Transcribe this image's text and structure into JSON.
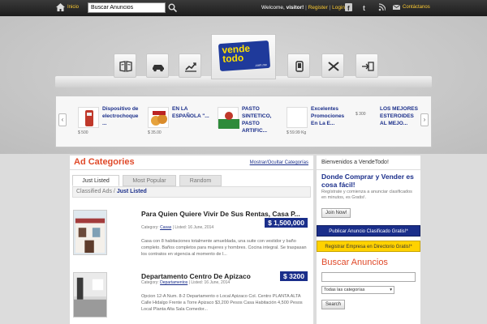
{
  "topbar": {
    "home_label": "Inicio",
    "search_value": "Buscar Anuncios",
    "welcome_text": "Welcome,",
    "welcome_user": "visitor!",
    "register_label": "Register",
    "login_label": "Login",
    "contact_label": "Contáctanos"
  },
  "logo": {
    "line1": "vende",
    "line2": "todo",
    "domain": ".com.mx"
  },
  "carousel": [
    {
      "title": "Dispositivo de electrochoque ...",
      "price": "$ 500"
    },
    {
      "title": "EN LA ESPAÑOLA \"...",
      "price": "$ 35.00"
    },
    {
      "title": "PASTO SINTETICO, PASTO ARTIFIC...",
      "price": ""
    },
    {
      "title": "Excelentes Promociones En La E...",
      "price": "$ 59.99 Kg"
    },
    {
      "title": "LOS MEJORES ESTEROIDES AL MEJO...",
      "price": "$ 300"
    }
  ],
  "main": {
    "title": "Ad Categories",
    "toggle_label": "Mostrar/Ocultar Categorías",
    "tabs": [
      "Just Listed",
      "Most Popular",
      "Random"
    ],
    "crumb_root": "Classified Ads",
    "crumb_sep": " / ",
    "crumb_current": "Just Listed",
    "listings": [
      {
        "title": "Para Quien Quiere Vivir De Sus Rentas, Casa P...",
        "price": "$ 1,500,000",
        "category_label": "Category:",
        "category": "Casas",
        "listed": "| Listed: 16 June, 2014",
        "description": "Casa con 8 habitaciones totalmente amueblada, una suite con vestidor y baño completo. Baños completos para mujeres y hombres. Cocina integral. Se traspasan los contratos en vigencia al momento de l..."
      },
      {
        "title": "Departamento Centro De Apizaco",
        "price": "$ 3200",
        "category_label": "Category:",
        "category": "Departamentos",
        "listed": "| Listed: 16 June, 2014",
        "description": "Opcion 12-A Num. 8-2 Departamento o Local Apizaco Col. Centro PLANTA ALTA Calle Hidalgo Frente a Torre Apizaco $3,200 Pesos Casa Habitación 4,500 Pesos Local Planta Alta Sala Comedor..."
      }
    ]
  },
  "sidebar": {
    "welcome": "Bienvenidos a VendeTodo!",
    "headline": "Donde Comprar y Vender es cosa fácil!",
    "paragraph": "Regístrate y comienza a anunciar clasificados en minutos, es Gratis!.",
    "join_label": "Join Now!",
    "publish_label": "Publicar Anuncio Clasificado Gratis!*",
    "register_company_label": "Registrar Empresa en Directorio Gratis!*",
    "search_title": "Buscar Anuncios",
    "select_value": "Todas las categorías",
    "search_button": "Search"
  },
  "colors": {
    "accent_blue": "#1a2e8a",
    "accent_orange": "#e04a2a",
    "accent_yellow": "#ffd200"
  }
}
